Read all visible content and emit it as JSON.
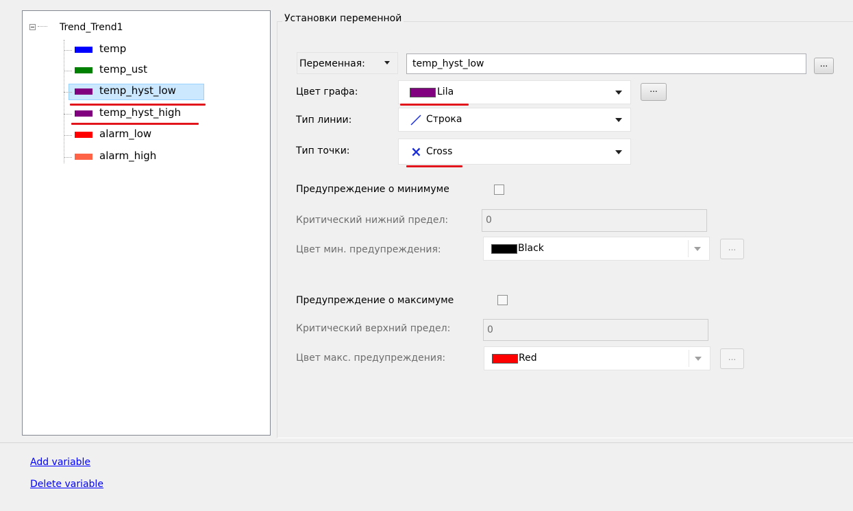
{
  "tree": {
    "root_label": "Trend_Trend1",
    "items": [
      {
        "label": "temp",
        "color": "#0000ff"
      },
      {
        "label": "temp_ust",
        "color": "#008000"
      },
      {
        "label": "temp_hyst_low",
        "color": "#800080",
        "selected": true
      },
      {
        "label": "temp_hyst_high",
        "color": "#800080"
      },
      {
        "label": "alarm_low",
        "color": "#ff0000"
      },
      {
        "label": "alarm_high",
        "color": "#ff6347"
      }
    ]
  },
  "settings": {
    "group_title": "Установки переменной",
    "variable_dropdown_label": "Переменная:",
    "variable_value": "temp_hyst_low",
    "graph_color_label": "Цвет графа:",
    "graph_color_value": "Lila",
    "graph_color_hex": "#800080",
    "line_type_label": "Тип линии:",
    "line_type_value": "Строка",
    "point_type_label": "Тип точки:",
    "point_type_value": "Cross",
    "point_glyph": "×",
    "min_warning_label": "Предупреждение о минимуме",
    "min_warning_checked": false,
    "critical_low_label": "Критический нижний предел:",
    "critical_low_value": "0",
    "min_warning_color_label": "Цвет мин. предупреждения:",
    "min_warning_color_value": "Black",
    "min_warning_color_hex": "#000000",
    "max_warning_label": "Предупреждение о максимуме",
    "max_warning_checked": false,
    "critical_high_label": "Критический верхний предел:",
    "critical_high_value": "0",
    "max_warning_color_label": "Цвет макс. предупреждения:",
    "max_warning_color_value": "Red",
    "max_warning_color_hex": "#ff0000",
    "ellipsis_label": "..."
  },
  "actions": {
    "add_variable": "Add variable",
    "delete_variable": "Delete variable"
  },
  "colors": {
    "annotation_red": "#e2141c",
    "link_blue": "#0000ff"
  }
}
